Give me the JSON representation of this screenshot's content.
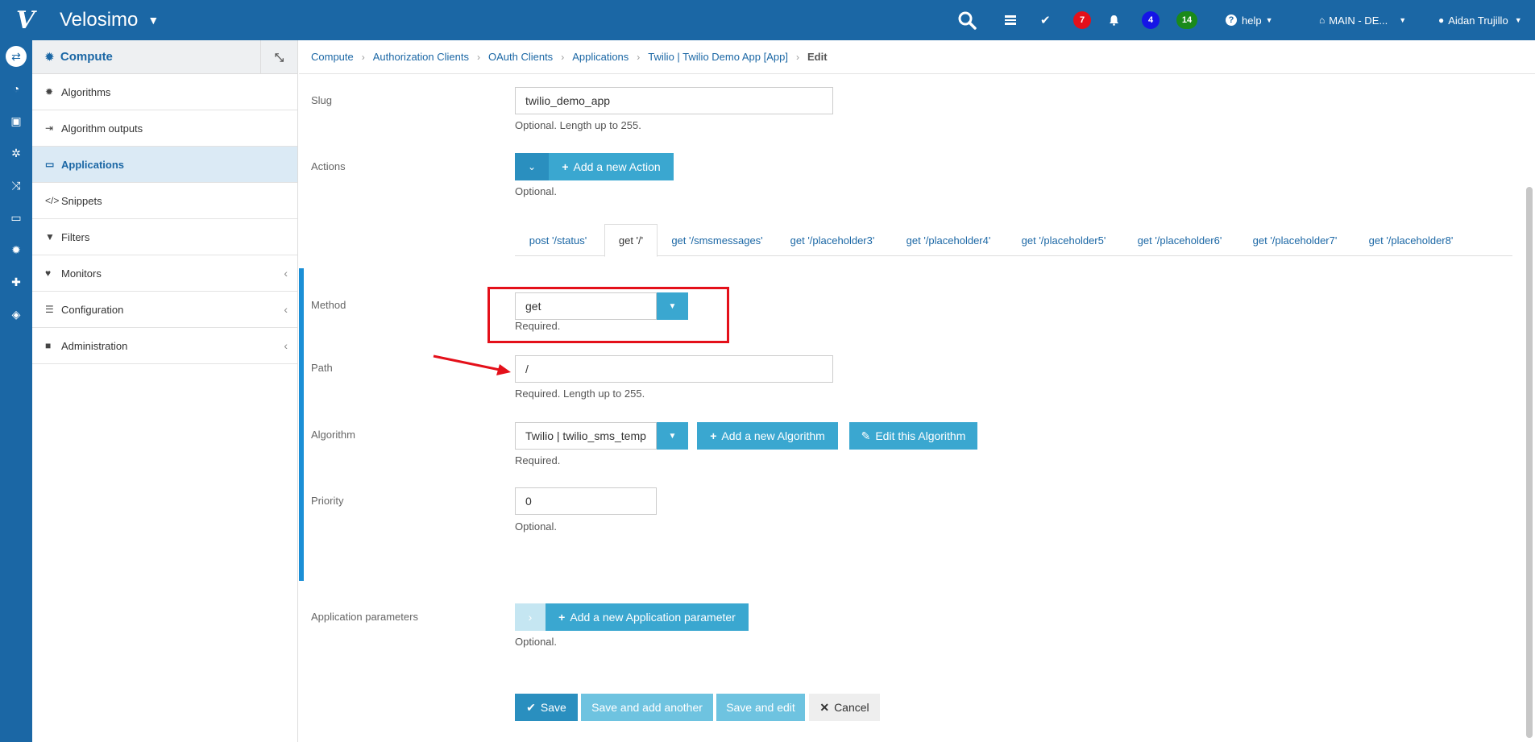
{
  "topbar": {
    "brand_logo": "V",
    "brand_name": "Velosimo",
    "badges": [
      "7",
      "4",
      "14"
    ],
    "help_label": "help",
    "env_label": "MAIN - DE...",
    "user_name": "Aidan Trujillo"
  },
  "sidenav": {
    "title": "Compute",
    "items": [
      {
        "label": "Algorithms",
        "icon": "gear-icon"
      },
      {
        "label": "Algorithm outputs",
        "icon": "sign-out-icon"
      },
      {
        "label": "Applications",
        "icon": "laptop-icon"
      },
      {
        "label": "Snippets",
        "icon": "code-icon"
      },
      {
        "label": "Filters",
        "icon": "filter-icon"
      },
      {
        "label": "Monitors",
        "icon": "heartbeat-icon"
      },
      {
        "label": "Configuration",
        "icon": "sliders-icon"
      },
      {
        "label": "Administration",
        "icon": "lock-icon"
      }
    ]
  },
  "breadcrumb": [
    "Compute",
    "Authorization Clients",
    "OAuth Clients",
    "Applications",
    "Twilio | Twilio Demo App [App]",
    "Edit"
  ],
  "form": {
    "slug": {
      "label": "Slug",
      "value": "twilio_demo_app",
      "help": "Optional. Length up to 255."
    },
    "actions": {
      "label": "Actions",
      "add_label": "Add a new Action",
      "help": "Optional."
    },
    "tabs": [
      "post '/status'",
      "get '/'",
      "get '/smsmessages'",
      "get '/placeholder3'",
      "get '/placeholder4'",
      "get '/placeholder5'",
      "get '/placeholder6'",
      "get '/placeholder7'",
      "get '/placeholder8'"
    ],
    "method": {
      "label": "Method",
      "value": "get",
      "help": "Required."
    },
    "path": {
      "label": "Path",
      "value": "/",
      "help": "Required. Length up to 255."
    },
    "algorithm": {
      "label": "Algorithm",
      "value": "Twilio | twilio_sms_temp",
      "add_label": "Add a new Algorithm",
      "edit_label": "Edit this Algorithm",
      "help": "Required."
    },
    "priority": {
      "label": "Priority",
      "value": "0",
      "help": "Optional."
    },
    "app_params": {
      "label": "Application parameters",
      "add_label": "Add a new Application parameter",
      "help": "Optional."
    }
  },
  "buttons": {
    "save": "Save",
    "save_add": "Save and add another",
    "save_edit": "Save and edit",
    "cancel": "Cancel"
  },
  "colors": {
    "primary": "#1b67a5",
    "button": "#3aa7d0",
    "highlight_box": "#e4101a",
    "badge_red": "#e4101a",
    "badge_blue": "#1515e6",
    "badge_green": "#1a8a1a"
  }
}
